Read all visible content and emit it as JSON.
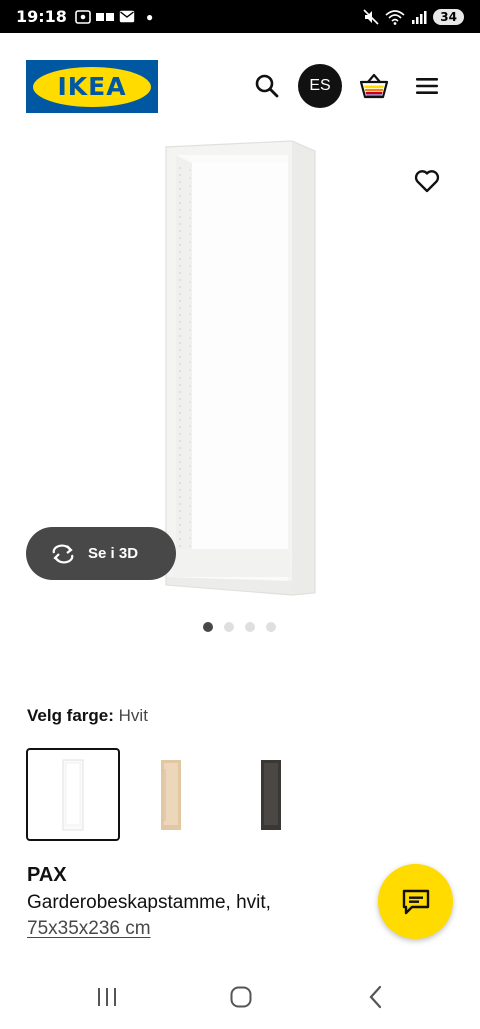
{
  "status_bar": {
    "time": "19:18",
    "battery": "34"
  },
  "header": {
    "logo_text": "IKEA",
    "profile_initials": "ES"
  },
  "product_gallery": {
    "view_3d_label": "Se i 3D",
    "image_count": 4,
    "active_image": 1
  },
  "color_select": {
    "label": "Velg farge:",
    "selected_value": "Hvit",
    "options": [
      {
        "name": "white",
        "color": "#ffffff"
      },
      {
        "name": "white-stained-oak",
        "color": "#e4c9a6"
      },
      {
        "name": "black-brown",
        "color": "#3c3a37"
      }
    ],
    "selected_index": 0
  },
  "product": {
    "name": "PAX",
    "description": "Garderobeskapstamme, hvit,",
    "size": "75x35x236 cm"
  },
  "colors": {
    "brand_blue": "#0058a3",
    "brand_yellow": "#ffdb00",
    "dark": "#111111",
    "button_grey": "#484848"
  },
  "icons": {
    "search": "search-icon",
    "cart": "shopping-bag-icon",
    "menu": "hamburger-menu-icon",
    "favourite": "heart-icon",
    "rotate_3d": "rotate-3d-icon",
    "chat": "chat-icon"
  }
}
